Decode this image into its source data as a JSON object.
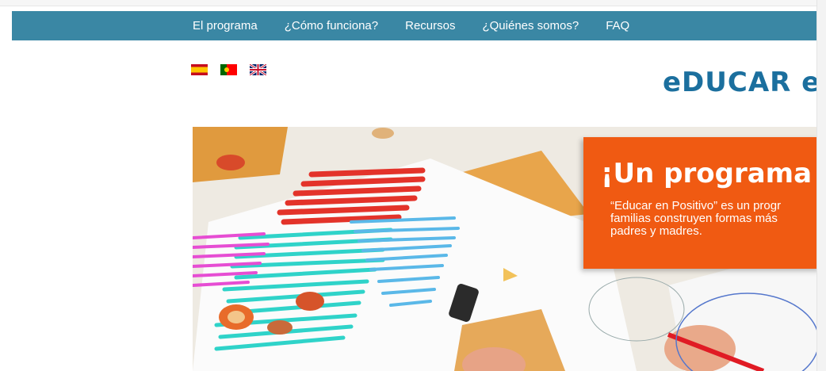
{
  "nav": {
    "items": [
      "El programa",
      "¿Cómo funciona?",
      "Recursos",
      "¿Quiénes somos?",
      "FAQ"
    ],
    "background": "#3a87a4"
  },
  "languages": [
    {
      "name": "spain-flag-icon"
    },
    {
      "name": "portugal-flag-icon"
    },
    {
      "name": "uk-flag-icon"
    }
  ],
  "logo": {
    "text": "eDUCAR e",
    "color": "#1b6f9e"
  },
  "hero": {
    "callout": {
      "title": "¡Un programa",
      "lines": [
        "“Educar en Positivo” es un progr",
        "familias construyen formas más",
        "padres y madres."
      ],
      "color": "#f05a12"
    }
  }
}
